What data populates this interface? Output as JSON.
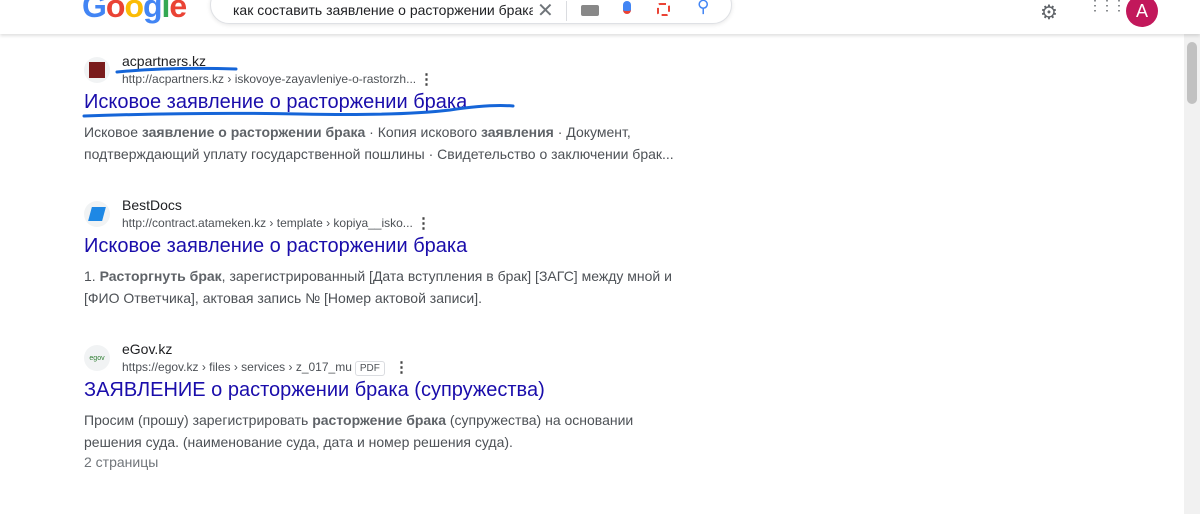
{
  "header": {
    "logo": "Google",
    "query": "как составить заявление о расторжении брака",
    "avatar": "A"
  },
  "results": [
    {
      "site": "acpartners.kz",
      "url": "http://acpartners.kz › iskovoye-zayavleniye-o-rastorzh...",
      "title": "Исковое заявление о расторжении брака",
      "snippet": [
        [
          "Исковое ",
          false
        ],
        [
          "заявление о расторжении брака",
          true
        ],
        [
          " · Копия искового ",
          false
        ],
        [
          "заявления",
          true
        ],
        [
          " · Документ, подтверждающий уплату государственной пошлины · Свидетельство о заключении брак...",
          false
        ]
      ]
    },
    {
      "site": "BestDocs",
      "url": "http://contract.atameken.kz › template › kopiya__isko...",
      "title": "Исковое заявление о расторжении брака",
      "snippet": [
        [
          "1. ",
          false
        ],
        [
          "Расторгнуть брак",
          true
        ],
        [
          ", зарегистрированный [Дата вступления в брак] [ЗАГС] между мной и [ФИО Ответчика], актовая запись № [Номер актовой записи].",
          false
        ]
      ]
    },
    {
      "site": "eGov.kz",
      "url": "https://egov.kz › files › services › z_017_mu",
      "badge": "PDF",
      "title": "ЗАЯВЛЕНИЕ о расторжении брака (супружества)",
      "snippet": [
        [
          "Просим (прошу) зарегистрировать ",
          false
        ],
        [
          "расторжение брака",
          true
        ],
        [
          " (супружества) на основании решения суда. (наименование суда, дата и номер решения суда).",
          false
        ]
      ],
      "pages": "2 страницы"
    }
  ]
}
